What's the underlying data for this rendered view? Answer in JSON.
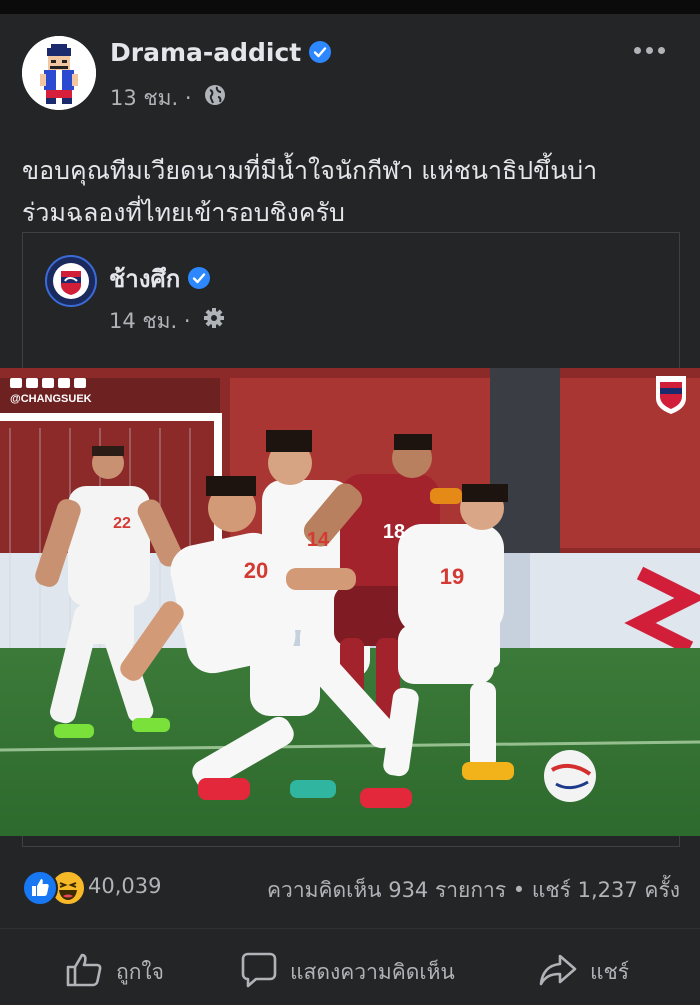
{
  "post": {
    "author": "Drama-addict",
    "time": "13 ชม.",
    "separator": "·",
    "text_line1": "ขอบคุณทีมเวียดนามที่มีน้ำใจนักกีฬา แห่ชนาธิปขึ้นบ่า",
    "text_line2": " ร่วมฉลองที่ไทยเข้ารอบชิงครับ",
    "privacy_icon": "globe-icon",
    "menu_icon": "more-horizontal-icon"
  },
  "shared_post": {
    "author": "ช้างศึก",
    "time": "14 ชม.",
    "separator": "·",
    "privacy_icon": "gear-icon",
    "photo": {
      "watermark": "@CHANGSUEK",
      "jersey_numbers": [
        "22",
        "20",
        "14",
        "18",
        "19"
      ],
      "description_icon": "football-photo"
    }
  },
  "engagement": {
    "reaction_icons": [
      "like-icon",
      "haha-icon"
    ],
    "reaction_count": "40,039",
    "stats": "ความคิดเห็น 934 รายการ • แชร์ 1,237 ครั้ง"
  },
  "actions": {
    "like": "ถูกใจ",
    "comment": "แสดงความคิดเห็น",
    "share": "แชร์"
  },
  "colors": {
    "background": "#18191a",
    "card": "#242526",
    "text_primary": "#e4e6eb",
    "text_secondary": "#b0b3b8",
    "verified": "#2d88ff"
  }
}
